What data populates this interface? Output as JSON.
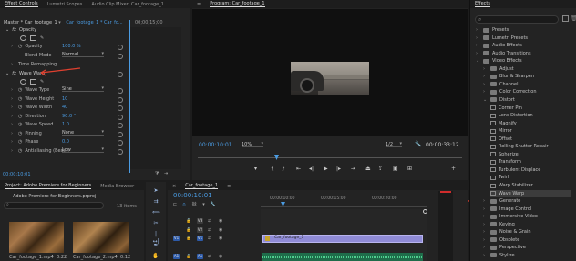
{
  "effect_controls": {
    "tabs": [
      "Effect Controls",
      "Lumetri Scopes",
      "Audio Clip Mixer: Car_footage_1"
    ],
    "source_master": "Master * Car_footage_1",
    "source_clip": "Car_footage_1 * Car_fo...",
    "opacity_section": "Opacity",
    "opacity_label": "Opacity",
    "opacity_value": "100.0 %",
    "blend_mode_label": "Blend Mode",
    "blend_mode_value": "Normal",
    "time_remapping": "Time Remapping",
    "wave_warp": "Wave Warp",
    "props": [
      {
        "label": "Wave Type",
        "value": "Sine",
        "dropdown": true
      },
      {
        "label": "Wave Height",
        "value": "10"
      },
      {
        "label": "Wave Width",
        "value": "40"
      },
      {
        "label": "Direction",
        "value": "90.0 °"
      },
      {
        "label": "Wave Speed",
        "value": "1.0"
      },
      {
        "label": "Pinning",
        "value": "None",
        "dropdown": true
      },
      {
        "label": "Phase",
        "value": "0.0"
      },
      {
        "label": "Antialiasing (Best...",
        "value": "Low",
        "dropdown": true
      }
    ],
    "mini_time": "00;00;15;00",
    "timecode": "00:00:10:01",
    "arrow_color": "#e0402f"
  },
  "program": {
    "title": "Program: Car_footage_1",
    "timecode": "00:00:10:01",
    "zoom": "10%",
    "resolution": "1/2",
    "duration": "00:00:33:12"
  },
  "project": {
    "tabs": [
      "Project: Adobe Premiere for Beginners",
      "Media Browser"
    ],
    "filename": "Adobe Premiere for Beginners.prproj",
    "items_count": "13 items",
    "clips": [
      {
        "name": "Car_footage_1.mp4",
        "duration": "0:22"
      },
      {
        "name": "Car_footage_2.mp4",
        "duration": "0:12"
      }
    ]
  },
  "timeline": {
    "tab": "Car_footage_1",
    "timecode": "00:00:10:01",
    "ruler": [
      "00:00:10:00",
      "00:00:15:00",
      "00:00:20:00"
    ],
    "tracks": [
      {
        "name": "V3",
        "target": ""
      },
      {
        "name": "V2",
        "target": ""
      },
      {
        "name": "V1",
        "target": "V1"
      },
      {
        "name": "A1",
        "target": "A1"
      }
    ],
    "clip_label": "Car_footage_1"
  },
  "effects": {
    "title": "Effects",
    "search_placeholder": "",
    "tree": [
      {
        "label": "Presets",
        "level": 0,
        "open": false
      },
      {
        "label": "Lumetri Presets",
        "level": 0,
        "open": false
      },
      {
        "label": "Audio Effects",
        "level": 0,
        "open": false
      },
      {
        "label": "Audio Transitions",
        "level": 0,
        "open": false
      },
      {
        "label": "Video Effects",
        "level": 0,
        "open": true
      },
      {
        "label": "Adjust",
        "level": 1,
        "open": false
      },
      {
        "label": "Blur & Sharpen",
        "level": 1,
        "open": false
      },
      {
        "label": "Channel",
        "level": 1,
        "open": false
      },
      {
        "label": "Color Correction",
        "level": 1,
        "open": false
      },
      {
        "label": "Distort",
        "level": 1,
        "open": true
      },
      {
        "label": "Corner Pin",
        "level": 2
      },
      {
        "label": "Lens Distortion",
        "level": 2
      },
      {
        "label": "Magnify",
        "level": 2
      },
      {
        "label": "Mirror",
        "level": 2
      },
      {
        "label": "Offset",
        "level": 2
      },
      {
        "label": "Rolling Shutter Repair",
        "level": 2
      },
      {
        "label": "Spherize",
        "level": 2
      },
      {
        "label": "Transform",
        "level": 2
      },
      {
        "label": "Turbulent Displace",
        "level": 2
      },
      {
        "label": "Twirl",
        "level": 2
      },
      {
        "label": "Warp Stabilizer",
        "level": 2
      },
      {
        "label": "Wave Warp",
        "level": 2,
        "selected": true
      },
      {
        "label": "Generate",
        "level": 1,
        "open": false
      },
      {
        "label": "Image Control",
        "level": 1,
        "open": false
      },
      {
        "label": "Immersive Video",
        "level": 1,
        "open": false
      },
      {
        "label": "Keying",
        "level": 1,
        "open": false
      },
      {
        "label": "Noise & Grain",
        "level": 1,
        "open": false
      },
      {
        "label": "Obsolete",
        "level": 1,
        "open": false
      },
      {
        "label": "Perspective",
        "level": 1,
        "open": false
      },
      {
        "label": "Stylize",
        "level": 1,
        "open": false
      }
    ]
  }
}
